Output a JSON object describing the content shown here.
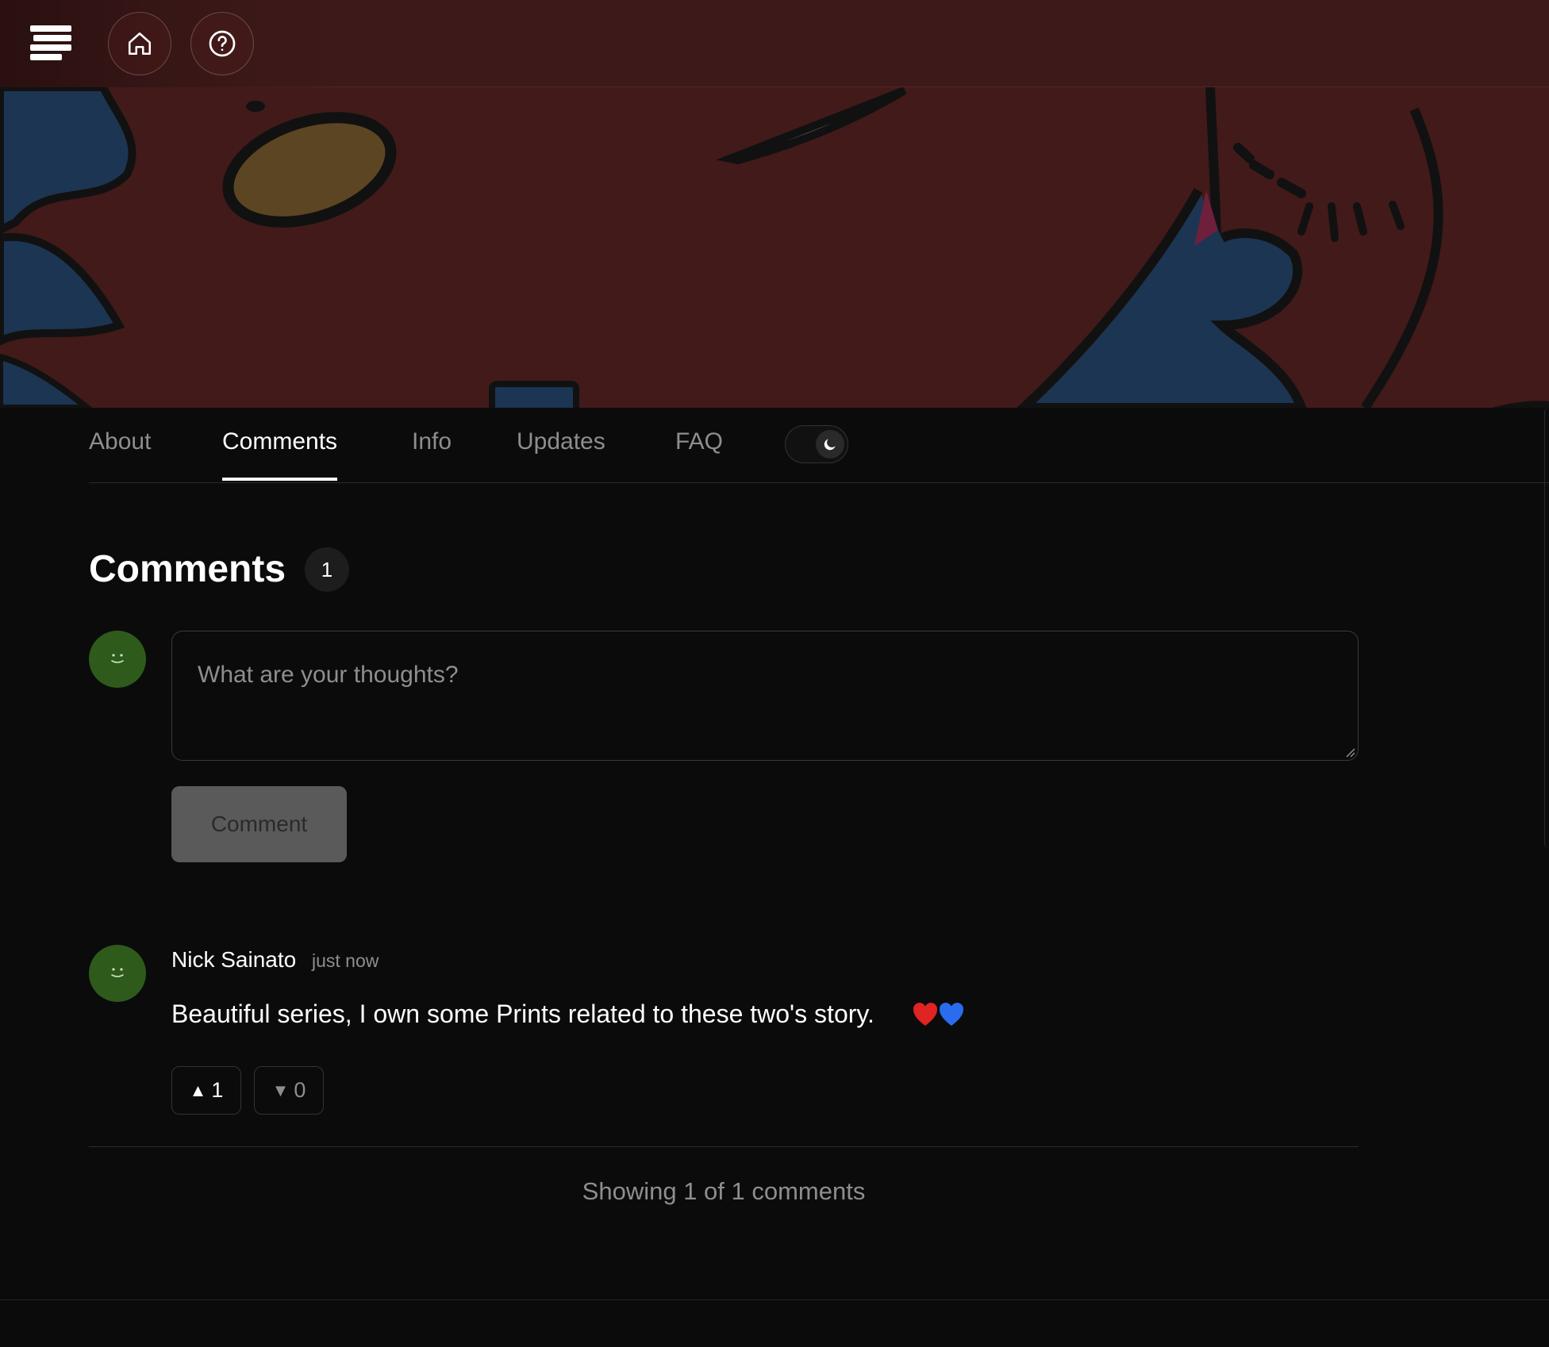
{
  "header": {
    "logo_icon": "stack-logo-icon",
    "home_icon": "home-icon",
    "help_icon": "help-icon"
  },
  "tabs": [
    {
      "label": "About",
      "active": false
    },
    {
      "label": "Comments",
      "active": true
    },
    {
      "label": "Info",
      "active": false
    },
    {
      "label": "Updates",
      "active": false
    },
    {
      "label": "FAQ",
      "active": false
    }
  ],
  "theme_toggle": {
    "mode": "dark",
    "icon": "moon-icon"
  },
  "comments": {
    "title": "Comments",
    "count": "1",
    "composer": {
      "placeholder": "What are your thoughts?",
      "value": "",
      "submit_label": "Comment"
    },
    "items": [
      {
        "author": "Nick Sainato",
        "time": "just now",
        "body": "Beautiful series, I own some Prints related to these two's story.",
        "emoji_icons": [
          "red-heart-icon",
          "blue-heart-icon"
        ],
        "upvotes": "1",
        "downvotes": "0"
      }
    ],
    "showing_text": "Showing 1 of 1 comments"
  },
  "colors": {
    "page_background": "#0b0b0b",
    "banner_red": "#421a1a",
    "avatar_green": "#2e5a1c",
    "button_gray": "#5a5a5a"
  }
}
